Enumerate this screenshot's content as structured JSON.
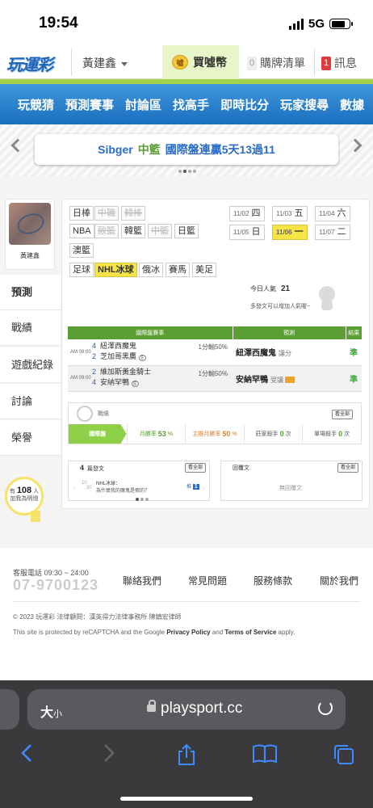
{
  "status_bar": {
    "time": "19:54",
    "network": "5G"
  },
  "header": {
    "logo": "玩運彩",
    "user_name": "黃建鑫",
    "buy_label": "買噓幣",
    "coin_glyph": "噓",
    "cart_count": "0",
    "cart_label": "購牌清單",
    "msg_count": "1",
    "msg_label": "訊息"
  },
  "nav": [
    "玩競猜",
    "預測賽事",
    "討論區",
    "找高手",
    "即時比分",
    "玩家搜尋",
    "數據"
  ],
  "banner": {
    "prefix": "Sibger",
    "tag": "中籃",
    "text": "國際盤連贏5天13過11"
  },
  "profile": {
    "name": "黃建鑫"
  },
  "side_tabs": [
    "預測",
    "戰績",
    "遊戲紀錄",
    "討論",
    "榮譽"
  ],
  "fans": {
    "prefix": "有",
    "count": "108",
    "suffix": "人",
    "label": "加我為明燈"
  },
  "leagues": [
    {
      "label": "日棒",
      "state": "on"
    },
    {
      "label": "中職",
      "state": "off"
    },
    {
      "label": "韓棒",
      "state": "off"
    },
    {
      "label": "NBA",
      "state": "on"
    },
    {
      "label": "歐籃",
      "state": "off"
    },
    {
      "label": "韓籃",
      "state": "on"
    },
    {
      "label": "中籃",
      "state": "off"
    },
    {
      "label": "日籃",
      "state": "on"
    },
    {
      "label": "澳籃",
      "state": "on"
    },
    {
      "label": "足球",
      "state": "on"
    },
    {
      "label": "NHL冰球",
      "state": "selected"
    },
    {
      "label": "俄冰",
      "state": "on"
    },
    {
      "label": "賽馬",
      "state": "on"
    },
    {
      "label": "美足",
      "state": "on"
    }
  ],
  "dates": [
    {
      "date": "11/02",
      "day": "四"
    },
    {
      "date": "11/03",
      "day": "五"
    },
    {
      "date": "11/04",
      "day": "六"
    },
    {
      "date": "11/05",
      "day": "日"
    },
    {
      "date": "11/06",
      "day": "一",
      "selected": true
    },
    {
      "date": "11/07",
      "day": "二"
    }
  ],
  "popularity": {
    "label": "今日人氣",
    "value": "21"
  },
  "hint": "多發文可以增加人氣喔~",
  "table": {
    "headers": [
      "國際盤賽事",
      "預測",
      "結果"
    ],
    "rows": [
      {
        "time": "AM 08:00",
        "team1_num": "4",
        "team1": "紐澤西魔鬼",
        "team2_num": "2",
        "team2": "芝加哥黑鷹",
        "home": "主",
        "odds": "1分輸50%",
        "pick": "紐澤西魔鬼",
        "pick_note": "讓分",
        "result": "準"
      },
      {
        "time": "AM 09:00",
        "team1_num": "2",
        "team1": "維加斯黃金騎士",
        "team2_num": "4",
        "team2": "安納罕鴨",
        "home": "主",
        "odds": "1分輸50%",
        "pick": "安納罕鴨",
        "pick_note": "受讓",
        "result": "準"
      }
    ]
  },
  "record": {
    "title": "戰績",
    "view_all": "看全部",
    "items": [
      {
        "label": "國際盤",
        "value": ""
      },
      {
        "label": "月勝率",
        "value": "53",
        "unit": "%"
      },
      {
        "label": "主推月勝率",
        "value": "50",
        "unit": "%"
      },
      {
        "label": "莊家殺手",
        "value": "0",
        "unit": "次"
      },
      {
        "label": "單場殺手",
        "value": "0",
        "unit": "次"
      }
    ]
  },
  "posts": {
    "count": "4",
    "title": "篇發文",
    "view_all": "看全部",
    "month": "10",
    "day": "30",
    "item_title": "NHL冰球：",
    "item_sub": "為什麼我的魔鬼是假的？",
    "push_label": "推",
    "push_count": "1"
  },
  "replies": {
    "title": "回覆文",
    "view_all": "看全部",
    "empty": "無回覆文"
  },
  "footer": {
    "service_label": "客服電話 09:30 ~ 24:00",
    "phone": "07-9700123",
    "links": [
      "聯絡我們",
      "常見問題",
      "服務條款",
      "關於我們"
    ],
    "copyright": "© 2023 玩運彩 法律顧問：漢英得力法律事務所 陳鎮宏律師",
    "recaptcha_prefix": "This site is protected by reCAPTCHA and the Google",
    "privacy": "Privacy Policy",
    "and": "and",
    "terms": "Terms of Service",
    "apply": "apply."
  },
  "browser": {
    "text_size": "大",
    "text_size_small": "小",
    "url": "playsport.cc"
  }
}
